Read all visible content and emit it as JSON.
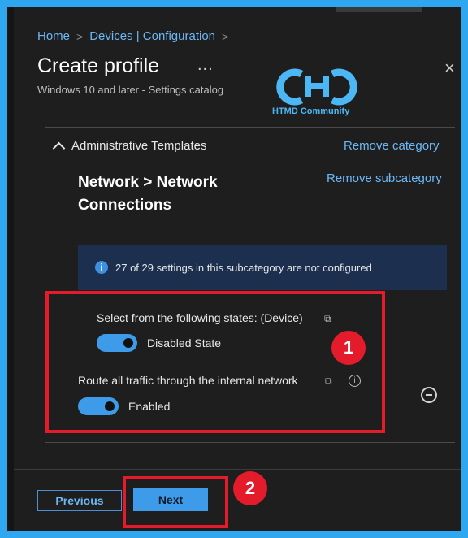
{
  "breadcrumb": {
    "items": [
      "Home",
      "Devices | Configuration"
    ],
    "separator": ">"
  },
  "header": {
    "title": "Create profile",
    "more": "...",
    "subtitle": "Windows 10 and later - Settings catalog",
    "close": "×"
  },
  "watermark": {
    "text": "HTMD Community"
  },
  "section": {
    "category": "Administrative Templates",
    "remove_category": "Remove category",
    "subcategory": "Network > Network Connections",
    "remove_subcategory": "Remove subcategory"
  },
  "info": {
    "icon": "i",
    "text": "27 of 29 settings in this subcategory are not configured"
  },
  "settings": [
    {
      "label": "Select from the following states: (Device)",
      "value": "Disabled State",
      "on": true
    },
    {
      "label": "Route all traffic through the internal network",
      "value": "Enabled",
      "on": true
    }
  ],
  "annotations": {
    "badge1": "1",
    "badge2": "2"
  },
  "footer": {
    "previous": "Previous",
    "next": "Next"
  },
  "colors": {
    "accent": "#3e9bea",
    "link": "#6cb8f6",
    "highlight": "#e31b2a",
    "background": "#1e1e1e",
    "frame": "#2ea6f0"
  }
}
